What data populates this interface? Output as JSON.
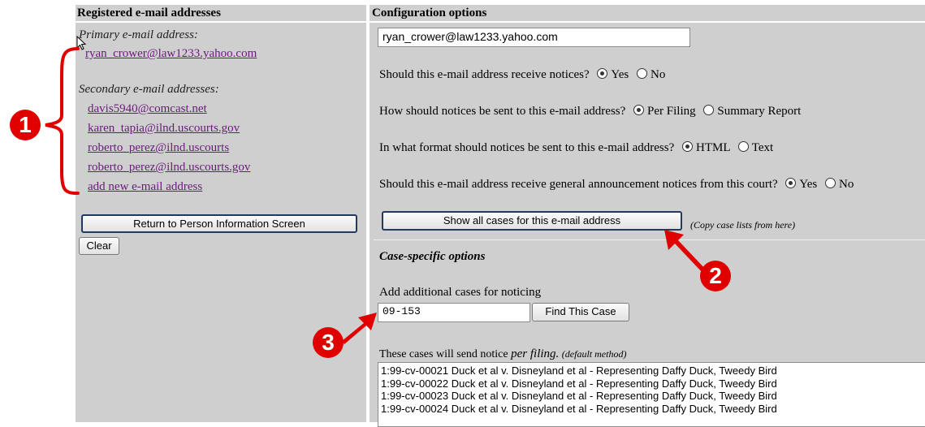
{
  "left": {
    "header": "Registered e-mail addresses",
    "primary_label": "Primary e-mail address:",
    "primary_email": "ryan_crower@law1233.yahoo.com",
    "secondary_label": "Secondary e-mail addresses:",
    "secondary_emails": [
      "davis5940@comcast.net",
      "karen_tapia@ilnd.uscourts.gov",
      "roberto_perez@ilnd.uscourts",
      "roberto_perez@ilnd.uscourts.gov"
    ],
    "add_new": "add new e-mail address",
    "return_button": "Return to Person Information Screen",
    "clear_button": "Clear"
  },
  "right": {
    "header": "Configuration options",
    "email_value": "ryan_crower@law1233.yahoo.com",
    "q1": {
      "text": "Should this e-mail address receive notices?",
      "options": [
        "Yes",
        "No"
      ],
      "selected": "Yes"
    },
    "q2": {
      "text": "How should notices be sent to this e-mail address?",
      "options": [
        "Per Filing",
        "Summary Report"
      ],
      "selected": "Per Filing"
    },
    "q3": {
      "text": "In what format should notices be sent to this e-mail address?",
      "options": [
        "HTML",
        "Text"
      ],
      "selected": "HTML"
    },
    "q4": {
      "text": "Should this e-mail address receive general announcement notices from this court?",
      "options": [
        "Yes",
        "No"
      ],
      "selected": "Yes"
    },
    "show_cases_button": "Show all cases for this e-mail address",
    "copy_note": "(Copy case lists from here)",
    "case_specific": "Case-specific options",
    "add_cases_label": "Add additional cases for noticing",
    "case_input_value": "09-153",
    "find_case_button": "Find This Case",
    "per_filing_prefix": "These cases will send notice ",
    "per_filing_em": "per filing.",
    "default_method": "(default method)",
    "cases": [
      "1:99-cv-00021 Duck et al v. Disneyland et al - Representing Daffy Duck, Tweedy Bird",
      "1:99-cv-00022 Duck et al v. Disneyland et al - Representing Daffy Duck, Tweedy Bird",
      "1:99-cv-00023 Duck et al v. Disneyland et al - Representing Daffy Duck, Tweedy Bird",
      "1:99-cv-00024 Duck et al v. Disneyland et al - Representing Daffy Duck, Tweedy Bird"
    ]
  },
  "callouts": {
    "one": "1",
    "two": "2",
    "three": "3"
  },
  "colors": {
    "panel": "#cfcfcf",
    "link": "#6a1b7a",
    "callout": "#e00000"
  }
}
